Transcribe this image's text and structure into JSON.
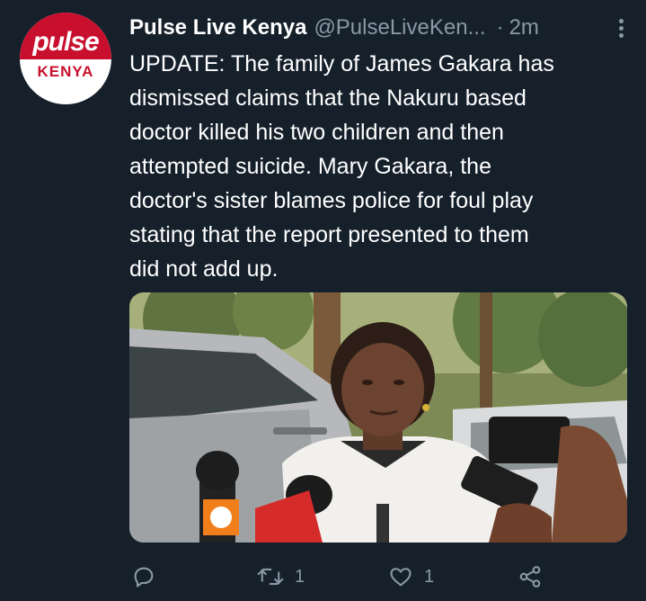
{
  "account": {
    "display_name": "Pulse Live Kenya",
    "handle": "@PulseLiveKen...",
    "separator": "·",
    "time": "2m",
    "avatar": {
      "logo_text": "pulse",
      "label": "KENYA",
      "brand_color": "#c8102e"
    }
  },
  "tweet": {
    "text": "UPDATE: The family of James Gakara has\ndismissed claims that the Nakuru based\ndoctor killed his two children and then\nattempted suicide. Mary Gakara, the\ndoctor's sister blames police for foul play\nstating that the report presented to them\ndid not add up."
  },
  "actions": {
    "reply": {
      "icon": "reply-icon",
      "count": ""
    },
    "retweet": {
      "icon": "retweet-icon",
      "count": "1"
    },
    "like": {
      "icon": "heart-icon",
      "count": "1"
    },
    "share": {
      "icon": "share-icon",
      "count": ""
    }
  },
  "colors": {
    "background": "#15202b",
    "primary_text": "#ffffff",
    "secondary_text": "#8b98a5"
  }
}
